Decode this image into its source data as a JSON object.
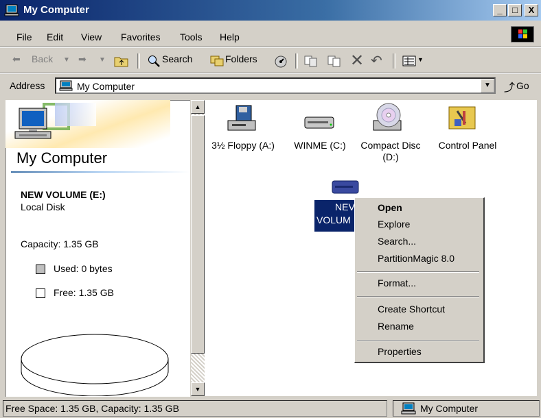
{
  "window": {
    "title": "My Computer",
    "minimize": "_",
    "maximize": "□",
    "close": "X"
  },
  "menu": [
    "File",
    "Edit",
    "View",
    "Favorites",
    "Tools",
    "Help"
  ],
  "toolbar": {
    "back": "Back",
    "search": "Search",
    "folders": "Folders"
  },
  "address": {
    "label": "Address",
    "value": "My Computer",
    "go": "Go"
  },
  "left": {
    "title": "My Computer",
    "volume_name": "NEW VOLUME (E:)",
    "volume_type": "Local Disk",
    "capacity": "Capacity: 1.35 GB",
    "used": "Used: 0 bytes",
    "free": "Free: 1.35 GB"
  },
  "drives": [
    {
      "label": "3½ Floppy (A:)"
    },
    {
      "label": "WINME (C:)"
    },
    {
      "label_line1": "Compact Disc",
      "label_line2": "(D:)"
    },
    {
      "label": "Control Panel"
    }
  ],
  "selected_drive": {
    "line1": "NEV",
    "line2": "VOLUM"
  },
  "context_menu": {
    "open": "Open",
    "explore": "Explore",
    "search": "Search...",
    "partition": "PartitionMagic 8.0",
    "format": "Format...",
    "shortcut": "Create Shortcut",
    "rename": "Rename",
    "properties": "Properties"
  },
  "status": {
    "left": "Free Space: 1.35 GB, Capacity: 1.35 GB",
    "right": "My Computer"
  }
}
